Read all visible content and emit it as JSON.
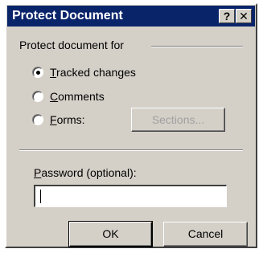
{
  "dialog": {
    "title": "Protect Document",
    "help_label": "?",
    "close_label": "✕"
  },
  "protect_group": {
    "label": "Protect document for",
    "options": [
      {
        "mnemonic": "T",
        "rest": "racked changes",
        "selected": true
      },
      {
        "mnemonic": "C",
        "rest": "omments",
        "selected": false
      },
      {
        "mnemonic": "F",
        "rest": "orms:",
        "selected": false
      }
    ],
    "sections_label": "Sections..."
  },
  "password": {
    "label_mnemonic": "P",
    "label_rest": "assword (optional):",
    "value": ""
  },
  "buttons": {
    "ok_label": "OK",
    "cancel_label": "Cancel"
  },
  "colors": {
    "titlebar": "#0a246a",
    "face": "#d4d0c8"
  }
}
